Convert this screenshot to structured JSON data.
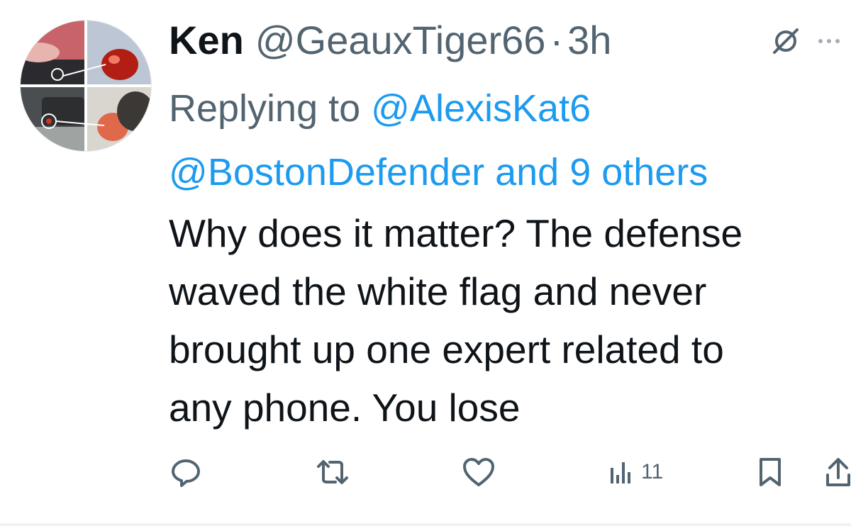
{
  "tweet": {
    "author_name": "Ken",
    "handle": "@GeauxTiger66",
    "separator": "·",
    "time": "3h",
    "replying_prefix": "Replying to ",
    "reply_mention_1": "@AlexisKat6",
    "reply_mention_2": "@BostonDefender",
    "reply_and": " and ",
    "reply_others": "9 others",
    "body": "Why does it matter?  The defense\nwaved the white flag and never\nbrought up one expert related to\nany phone.  You lose"
  },
  "actions": {
    "views": "11"
  },
  "icons": {
    "avatar": "avatar-collage",
    "grok": "grok-icon",
    "more": "more-icon",
    "reply": "reply-icon",
    "retweet": "retweet-icon",
    "like": "like-icon",
    "views": "views-icon",
    "bookmark": "bookmark-icon",
    "share": "share-icon"
  },
  "colors": {
    "text_primary": "#0f1419",
    "text_secondary": "#536471",
    "link": "#1d9bf0",
    "icon": "#536471"
  }
}
